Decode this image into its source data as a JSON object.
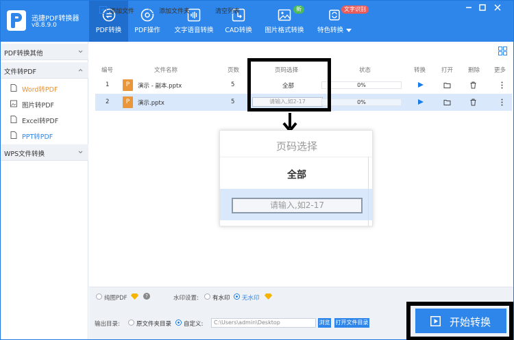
{
  "app": {
    "name": "迅捷PDF转换器",
    "version": "v8.8.9.0"
  },
  "nav": [
    {
      "label": "PDF转换",
      "icon": "pdf-convert-icon",
      "active": true
    },
    {
      "label": "PDF操作",
      "icon": "pdf-operate-icon"
    },
    {
      "label": "文字语音转换",
      "icon": "audio-wave-icon"
    },
    {
      "label": "CAD转换",
      "icon": "cad-icon"
    },
    {
      "label": "图片格式转换",
      "icon": "image-icon",
      "badge": "新"
    },
    {
      "label": "特色转换",
      "icon": "special-convert-icon",
      "badge": "文字识别"
    }
  ],
  "sidebar": {
    "groups": [
      {
        "label": "PDF转换其他"
      },
      {
        "label": "文件转PDF"
      },
      {
        "label": "WPS文件转换"
      }
    ],
    "items": [
      {
        "label": "Word转PDF"
      },
      {
        "label": "图片转PDF"
      },
      {
        "label": "Excel转PDF"
      },
      {
        "label": "PPT转PDF"
      }
    ]
  },
  "toolbar": {
    "add_file": "添加文件",
    "add_folder": "添加文件夹",
    "clear_list": "清空列表"
  },
  "table": {
    "headers": [
      "编号",
      "文件名称",
      "页数",
      "页码选择",
      "状态",
      "转换",
      "打开",
      "删除",
      "更多"
    ],
    "rows": [
      {
        "index": "1",
        "filename": "演示 - 副本.pptx",
        "pages": "5",
        "page_select": "全部",
        "status": "0%"
      },
      {
        "index": "2",
        "filename": "演示.pptx",
        "pages": "5",
        "page_select_placeholder": "请输入,如2-17",
        "status": "0%"
      }
    ],
    "file_icon_letter": "P"
  },
  "zoom": {
    "title": "页码选择",
    "value": "全部",
    "placeholder": "请输入,如2-17"
  },
  "bottom": {
    "pure_image_pdf": "纯图PDF",
    "help": "?",
    "watermark_label": "水印设置:",
    "with_watermark": "有水印",
    "no_watermark": "无水印",
    "output_label": "输出目录:",
    "source_dir": "原文件夹目录",
    "custom": "自定义:",
    "path": "C:\\Users\\admin\\Desktop",
    "browse": "浏览",
    "open_folder": "打开文件目录",
    "start": "开始转换"
  },
  "colors": {
    "primary": "#2f86ea",
    "active_nav": "#1f6dcc",
    "badge_green": "#4cbb5a",
    "badge_red": "#e85c5c",
    "accent_orange": "#e8902b"
  }
}
